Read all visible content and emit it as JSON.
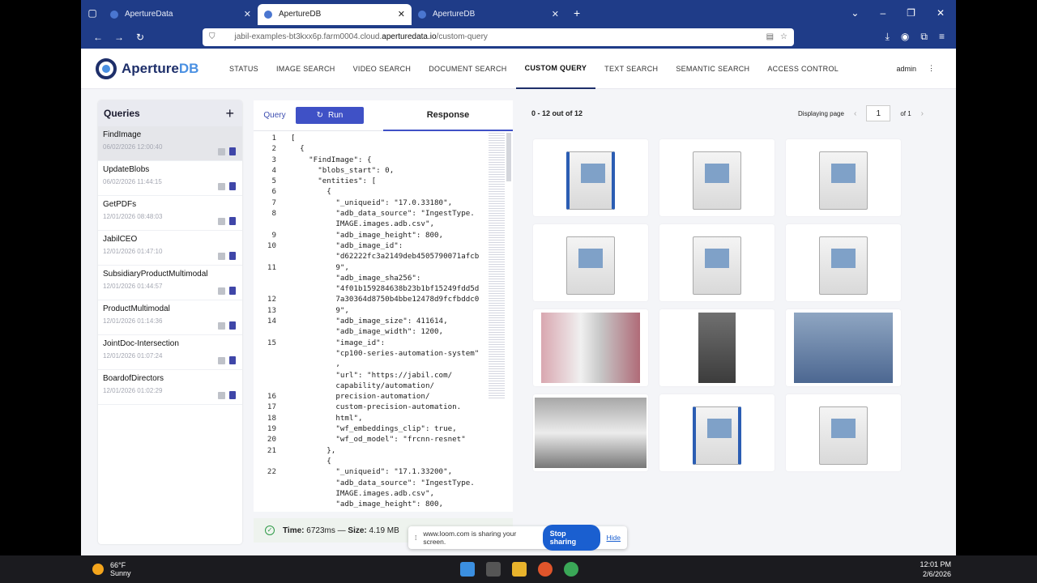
{
  "browser": {
    "tabs": [
      {
        "label": "ApertureData",
        "active": false
      },
      {
        "label": "ApertureDB",
        "active": true
      },
      {
        "label": "ApertureDB",
        "active": false
      }
    ],
    "url_prefix": "jabil-examples-bt3kxx6p.farm0004.cloud.",
    "url_domain": "aperturedata.io",
    "url_path": "/custom-query"
  },
  "app": {
    "logo_name_a": "Aperture",
    "logo_name_b": "DB",
    "nav": [
      "STATUS",
      "IMAGE SEARCH",
      "VIDEO SEARCH",
      "DOCUMENT SEARCH",
      "CUSTOM QUERY",
      "TEXT SEARCH",
      "SEMANTIC SEARCH",
      "ACCESS CONTROL"
    ],
    "active_nav": "CUSTOM QUERY",
    "user": "admin"
  },
  "queries": {
    "title": "Queries",
    "add_glyph": "+",
    "items": [
      {
        "name": "FindImage",
        "date": "06/02/2026 12:00:40"
      },
      {
        "name": "UpdateBlobs",
        "date": "06/02/2026 11:44:15"
      },
      {
        "name": "GetPDFs",
        "date": "12/01/2026 08:48:03"
      },
      {
        "name": "JabilCEO",
        "date": "12/01/2026 01:47:10"
      },
      {
        "name": "SubsidiaryProductMultimodal",
        "date": "12/01/2026 01:44:57"
      },
      {
        "name": "ProductMultimodal",
        "date": "12/01/2026 01:14:36"
      },
      {
        "name": "JointDoc-Intersection",
        "date": "12/01/2026 01:07:24"
      },
      {
        "name": "BoardofDirectors",
        "date": "12/01/2026 01:02:29"
      }
    ]
  },
  "editor": {
    "query_tab": "Query",
    "run_label": "Run",
    "response_tab": "Response",
    "gutter": [
      "1",
      "2",
      "3",
      "4",
      "5",
      "6",
      "7",
      "8",
      "",
      "9",
      "10",
      "",
      "11",
      "",
      "",
      "12",
      "13",
      "14",
      "",
      "15",
      "",
      "",
      "",
      "",
      "16",
      "17",
      "18",
      "19",
      "20",
      "21",
      "",
      "22"
    ],
    "lines": [
      "[",
      "  {",
      "    \"FindImage\": {",
      "      \"blobs_start\": 0,",
      "      \"entities\": [",
      "        {",
      "          \"_uniqueid\": \"17.0.33180\",",
      "          \"adb_data_source\": \"IngestType.",
      "          IMAGE.images.adb.csv\",",
      "          \"adb_image_height\": 800,",
      "          \"adb_image_id\":",
      "          \"d62222fc3a2149deb4505790071afcb",
      "          9\",",
      "          \"adb_image_sha256\":",
      "          \"4f01b159284638b23b1bf15249fdd5d",
      "          7a30364d8750b4bbe12478d9fcfbddc0",
      "          9\",",
      "          \"adb_image_size\": 411614,",
      "          \"adb_image_width\": 1200,",
      "          \"image_id\":",
      "          \"cp100-series-automation-system\"",
      "          ,",
      "          \"url\": \"https://jabil.com/",
      "          capability/automation/",
      "          precision-automation/",
      "          custom-precision-automation.",
      "          html\",",
      "          \"wf_embeddings_clip\": true,",
      "          \"wf_od_model\": \"frcnn-resnet\"",
      "        },",
      "        {",
      "          \"_uniqueid\": \"17.1.33200\",",
      "          \"adb_data_source\": \"IngestType.",
      "          IMAGE.images.adb.csv\",",
      "          \"adb_image_height\": 800,"
    ]
  },
  "status": {
    "time_label": "Time:",
    "time_value": "6723ms",
    "sep": "—",
    "size_label": "Size:",
    "size_value": "4.19 MB"
  },
  "results": {
    "count": "0 - 12 out of 12",
    "displaying_label": "Displaying page",
    "page": "1",
    "of_label": "of 1",
    "thumbs": [
      "machine-blue",
      "machine",
      "machine",
      "machine",
      "machine",
      "machine",
      "store",
      "dark",
      "factory",
      "full",
      "machine-blue",
      "machine"
    ]
  },
  "loom": {
    "text": "www.loom.com is sharing your screen.",
    "stop": "Stop sharing",
    "hide": "Hide"
  },
  "taskbar": {
    "temp": "66°F",
    "weather": "Sunny",
    "time": "12:01 PM",
    "date": "2/6/2026"
  }
}
